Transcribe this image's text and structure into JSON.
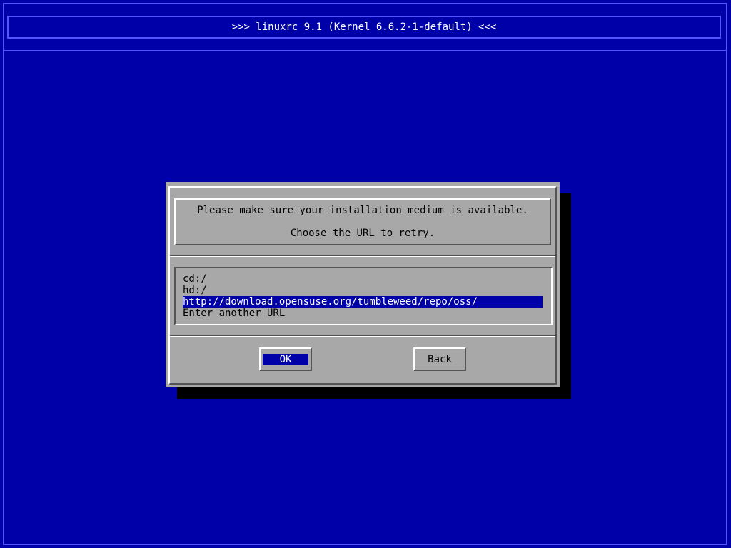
{
  "header": {
    "title": ">>> linuxrc 9.1 (Kernel 6.6.2-1-default) <<<"
  },
  "dialog": {
    "message_line1": "Please make sure your installation medium is available.",
    "message_line2": "Choose the URL to retry.",
    "options": [
      {
        "label": "cd:/",
        "selected": false
      },
      {
        "label": "hd:/",
        "selected": false
      },
      {
        "label": "http://download.opensuse.org/tumbleweed/repo/oss/",
        "selected": true
      },
      {
        "label": "Enter another URL",
        "selected": false
      }
    ],
    "ok_label": "OK",
    "back_label": "Back"
  },
  "colors": {
    "background": "#0000a8",
    "dialog": "#a8a8a8",
    "highlight": "#0000a8",
    "frame": "#5454fc"
  }
}
